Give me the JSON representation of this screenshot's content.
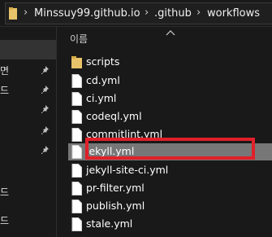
{
  "breadcrumb": {
    "separator": "›",
    "items": [
      "Minssuy99.github.io",
      ".github",
      "workflows"
    ]
  },
  "nav": {
    "items": [
      {
        "label": ""
      },
      {
        "label": "",
        "selected": true
      },
      {
        "label": "면",
        "pinned": true
      },
      {
        "label": "드",
        "pinned": true
      },
      {
        "label": "",
        "pinned": true
      },
      {
        "label": "",
        "pinned": true
      },
      {
        "label": "",
        "pinned": true
      },
      {
        "label": "드"
      },
      {
        "label": ""
      },
      {
        "label": ""
      },
      {
        "label": "드"
      }
    ]
  },
  "content": {
    "column_header": "이름",
    "files": [
      {
        "name": "scripts",
        "type": "folder-icon"
      },
      {
        "name": "cd.yml",
        "type": "file-icon"
      },
      {
        "name": "ci.yml",
        "type": "file-icon"
      },
      {
        "name": "codeql.yml",
        "type": "file-icon"
      },
      {
        "name": "commitlint.yml",
        "type": "file-icon"
      },
      {
        "name": "jekyll.yml",
        "type": "file-icon",
        "selected": true
      },
      {
        "name": "jekyll-site-ci.yml",
        "type": "file-icon"
      },
      {
        "name": "pr-filter.yml",
        "type": "file-icon"
      },
      {
        "name": "publish.yml",
        "type": "file-icon"
      },
      {
        "name": "stale.yml",
        "type": "file-icon"
      }
    ]
  },
  "colors": {
    "background": "#191919",
    "selection": "#777777",
    "highlight_border": "#e0202a",
    "folder": "#e8c36a"
  }
}
